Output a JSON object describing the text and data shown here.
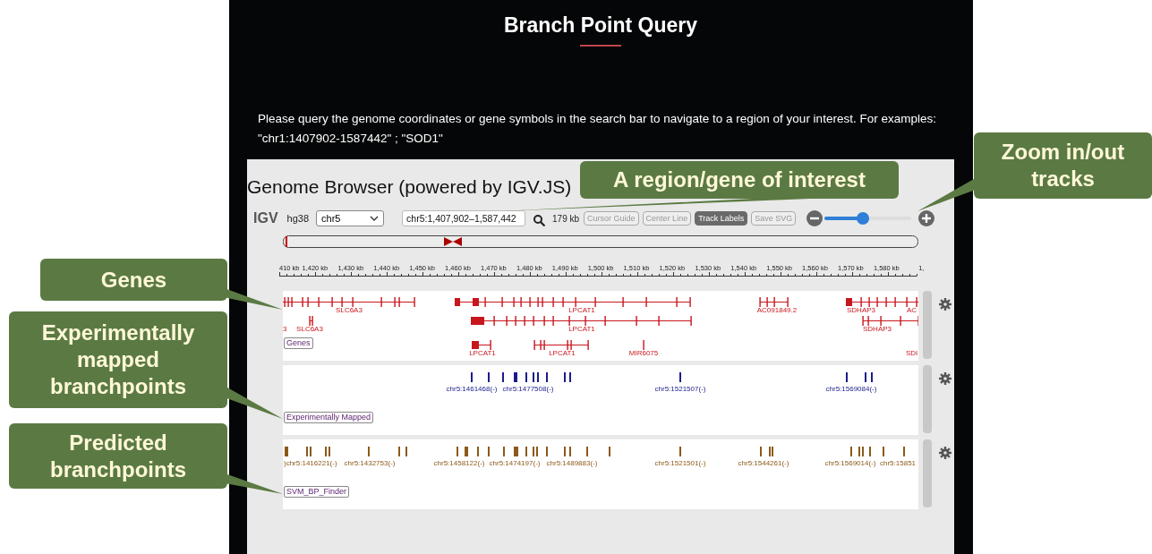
{
  "page": {
    "title": "Branch Point Query",
    "instructions": "Please query the genome coordinates or gene symbols in the search bar to navigate to a region of your interest. For examples: \"chr1:1407902-1587442\" ; \"SOD1\""
  },
  "browser": {
    "heading": "Genome Browser (powered by IGV.JS)",
    "toolbar": {
      "logo": "IGV",
      "genome": "hg38",
      "chromosome": "chr5",
      "locus": "chr5:1,407,902–1,587,442",
      "width": "179 kb",
      "buttons": [
        {
          "label": "Cursor Guide",
          "selected": false
        },
        {
          "label": "Center Line",
          "selected": false
        },
        {
          "label": "Track Labels",
          "selected": true
        },
        {
          "label": "Save SVG",
          "selected": false
        }
      ],
      "zoom": {
        "level": 0.44
      }
    },
    "ruler": [
      "410 kb",
      "1,420 kb",
      "1,430 kb",
      "1,440 kb",
      "1,450 kb",
      "1,460 kb",
      "1,470 kb",
      "1,480 kb",
      "1,490 kb",
      "1,500 kb",
      "1,510 kb",
      "1,520 kb",
      "1,530 kb",
      "1,540 kb",
      "1,550 kb",
      "1,560 kb",
      "1,570 kb",
      "1,580 kb",
      "1,"
    ],
    "tracks": [
      {
        "kind": "genes",
        "name": "Genes",
        "color": "#c8161d",
        "features": [
          "SLC6A3",
          "LPCAT1",
          "AC091849.2",
          "SDHAP3",
          "AC",
          "3",
          "SLC6A3",
          "LPCAT1",
          "SDHAP3",
          "LPCAT1",
          "LPCAT1",
          "MIR6075",
          "SDI"
        ]
      },
      {
        "kind": "points",
        "name": "Experimentally Mapped",
        "color": "#1c1c8c",
        "features": [
          "chr5:1461468(-)",
          "chr5:1477508(-)",
          "chr5:1521507(-)",
          "chr5:1569084(-)"
        ]
      },
      {
        "kind": "points",
        "name": "SVM_BP_Finder",
        "color": "#8b5a1a",
        "features": [
          ")chr5:1416221(-)",
          "chr5:1432753(-)",
          "chr5:1458122(-)",
          "chr5:1474197(-)",
          "chr5:1489883(-)",
          "chr5:1521501(-)",
          "chr5:1544261(-)",
          "chr5:1569014(-)",
          "chr5:15851"
        ]
      }
    ]
  },
  "callouts": [
    {
      "text": "A region/gene of interest"
    },
    {
      "text": "Zoom in/out tracks"
    },
    {
      "text": "Genes"
    },
    {
      "text": "Experimentally mapped branchpoints"
    },
    {
      "text": "Predicted branchpoints"
    }
  ]
}
